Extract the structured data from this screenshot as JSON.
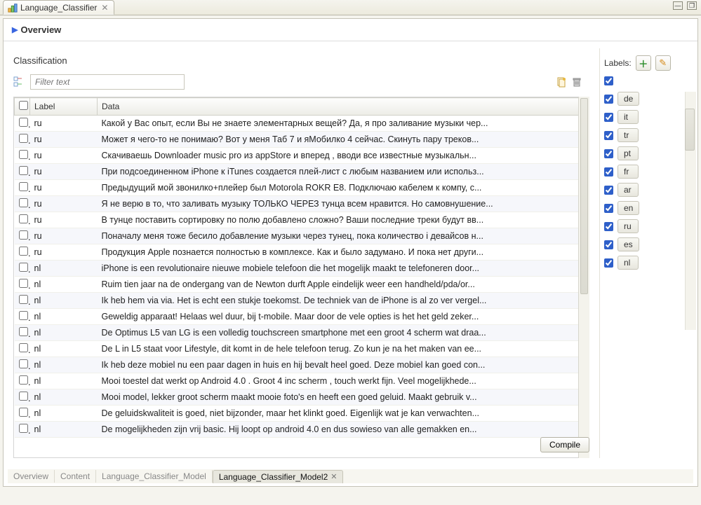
{
  "window": {
    "tab_title": "Language_Classifier"
  },
  "overview_header": "Overview",
  "classification": {
    "title": "Classification",
    "filter_placeholder": "Filter text",
    "columns": {
      "check": "",
      "label": "Label",
      "data": "Data"
    },
    "rows": [
      {
        "label": "ru",
        "data": "Какой у Вас опыт, если Вы не знаете элементарных вещей? Да, я про заливание музыки чер..."
      },
      {
        "label": "ru",
        "data": "Может я чего-то не понимаю? Вот у меня Таб 7 и яМобилко 4 сейчас. Скинуть пару треков..."
      },
      {
        "label": "ru",
        "data": "Скачиваешь Downloader music pro  из appStore  и вперед , вводи все известные музыкальн..."
      },
      {
        "label": "ru",
        "data": "При подсоединенном iPhone к iTunes создается плей-лист с любым названием или использ..."
      },
      {
        "label": "ru",
        "data": "Предыдущий мой звонилко+плейер был Motorola ROKR E8. Подключаю кабелем к компу, с..."
      },
      {
        "label": "ru",
        "data": "Я не верю в то, что заливать музыку ТОЛЬКО ЧЕРЕЗ тунца всем нравится. Но самовнушение..."
      },
      {
        "label": "ru",
        "data": "В тунце поставить сортировку по полю добавлено сложно? Ваши последние треки будут вв..."
      },
      {
        "label": "ru",
        "data": "Поначалу меня тоже бесило добавление музыки через тунец, пока количество i девайсов н..."
      },
      {
        "label": "ru",
        "data": "Продукция Apple познается полностью в комплексе. Как и было задумано. И пока нет други..."
      },
      {
        "label": "nl",
        "data": "iPhone is een revolutionaire nieuwe mobiele telefoon die het mogelijk maakt te telefoneren door..."
      },
      {
        "label": "nl",
        "data": "Ruim tien jaar na de ondergang van de Newton durft Apple eindelijk weer een handheld/pda/or..."
      },
      {
        "label": "nl",
        "data": "Ik heb hem via via. Het is echt een stukje toekomst. De techniek van de iPhone is al zo ver vergel..."
      },
      {
        "label": "nl",
        "data": "Geweldig apparaat! Helaas wel duur, bij t-mobile. Maar door de vele opties is het het geld zeker..."
      },
      {
        "label": "nl",
        "data": "De Optimus L5 van LG is een volledig touchscreen smartphone met een groot 4 scherm wat draa..."
      },
      {
        "label": "nl",
        "data": "De L in L5 staat voor Lifestyle, dit komt in de hele telefoon terug. Zo kun je na het maken van ee..."
      },
      {
        "label": "nl",
        "data": "Ik heb deze mobiel nu een paar dagen in huis en hij bevalt heel goed. Deze mobiel kan goed con..."
      },
      {
        "label": "nl",
        "data": "Mooi toestel dat werkt op Android 4.0 . Groot 4 inc scherm , touch werkt fijn.  Veel mogelijkhede..."
      },
      {
        "label": "nl",
        "data": "Mooi model, lekker groot scherm maakt mooie foto's en heeft een goed geluid. Maakt gebruik v..."
      },
      {
        "label": "nl",
        "data": "De geluidskwaliteit is goed, niet bijzonder, maar het klinkt goed. Eigenlijk wat je kan verwachten..."
      },
      {
        "label": "nl",
        "data": "De mogelijkheden zijn vrij basic. Hij loopt op android 4.0 en dus sowieso van alle gemakken en..."
      }
    ],
    "compile_label": "Compile"
  },
  "labels_panel": {
    "title": "Labels:",
    "master_checked": true,
    "items": [
      {
        "code": "de",
        "checked": true
      },
      {
        "code": "it",
        "checked": true
      },
      {
        "code": "tr",
        "checked": true
      },
      {
        "code": "pt",
        "checked": true
      },
      {
        "code": "fr",
        "checked": true
      },
      {
        "code": "ar",
        "checked": true
      },
      {
        "code": "en",
        "checked": true
      },
      {
        "code": "ru",
        "checked": true
      },
      {
        "code": "es",
        "checked": true
      },
      {
        "code": "nl",
        "checked": true
      }
    ]
  },
  "bottom_tabs": {
    "items": [
      {
        "label": "Overview",
        "active": false
      },
      {
        "label": "Content",
        "active": false
      },
      {
        "label": "Language_Classifier_Model",
        "active": false
      },
      {
        "label": "Language_Classifier_Model2",
        "active": true
      }
    ]
  }
}
